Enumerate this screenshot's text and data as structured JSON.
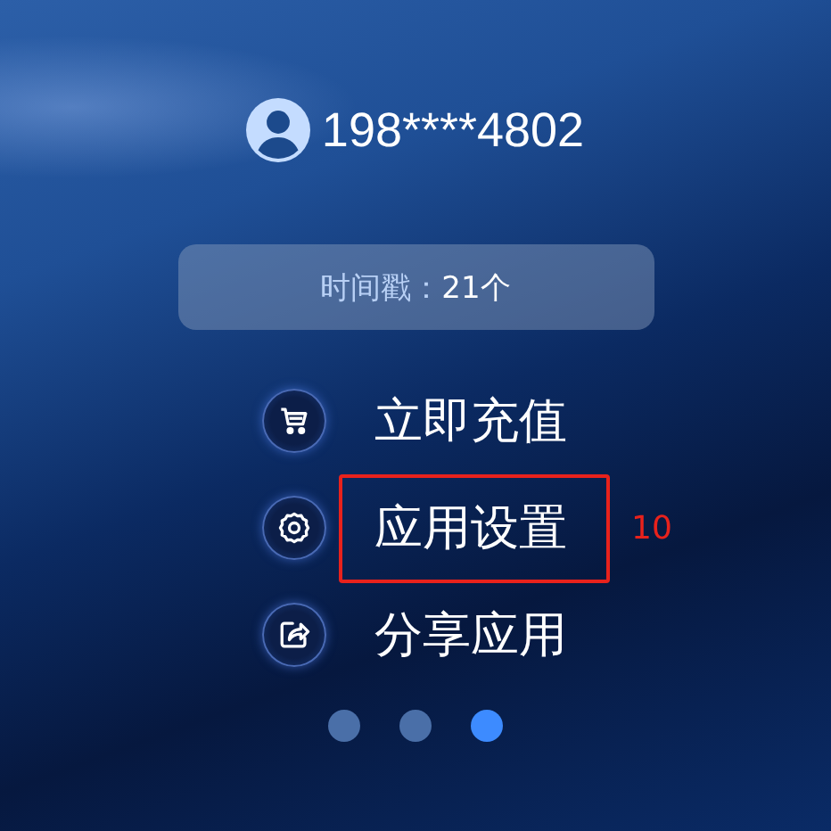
{
  "account": {
    "phone": "198****4802"
  },
  "timestamp": {
    "label": "时间戳：",
    "value": "21个"
  },
  "menu": [
    {
      "kind": "cart",
      "label": "立即充值",
      "highlighted": false
    },
    {
      "kind": "settings",
      "label": "应用设置",
      "highlighted": true
    },
    {
      "kind": "share",
      "label": "分享应用",
      "highlighted": false
    }
  ],
  "annotation": {
    "label": "10"
  },
  "pages": [
    {
      "selected": false
    },
    {
      "selected": false
    },
    {
      "selected": true
    }
  ]
}
